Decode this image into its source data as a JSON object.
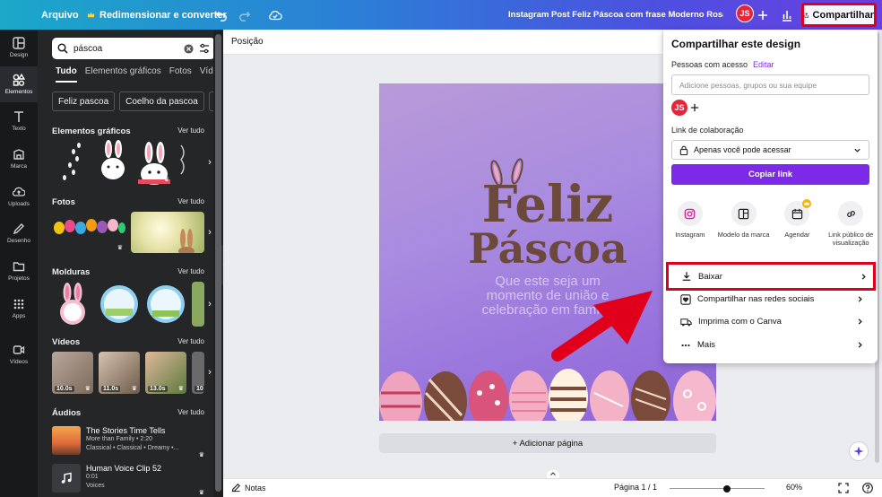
{
  "topbar": {
    "file_label": "Arquivo",
    "resize_label": "Redimensionar e converter",
    "doc_title": "Instagram Post Feliz Páscoa com frase Moderno Rosa e Mar...",
    "avatar_initials": "JS",
    "share_label": "Compartilhar"
  },
  "rail": {
    "items": [
      "Design",
      "Elementos",
      "Texto",
      "Marca",
      "Uploads",
      "Desenho",
      "Projetos",
      "Apps",
      "Vídeos"
    ]
  },
  "panel": {
    "search_value": "páscoa",
    "tabs": [
      "Tudo",
      "Elementos gráficos",
      "Fotos",
      "Vídeo"
    ],
    "chips": [
      "Feliz pascoa",
      "Coelho da pascoa",
      "C"
    ],
    "see_all": "Ver tudo",
    "sections": {
      "graphics": "Elementos gráficos",
      "photos": "Fotos",
      "frames": "Molduras",
      "videos": "Vídeos",
      "audios": "Áudios"
    },
    "video_durations": [
      "10.0s",
      "11.0s",
      "13.0s",
      "10"
    ],
    "audios": [
      {
        "title": "The Stories Time Tells",
        "artist": "More than Family • 2:20",
        "tags": "Classical • Classical • Dreamy •..."
      },
      {
        "title": "Human Voice Clip 52",
        "artist": "0:01",
        "tags": "Voices"
      }
    ]
  },
  "subbar": {
    "position_label": "Posição"
  },
  "design": {
    "line1": "Feliz",
    "line2": "Páscoa",
    "phrase": [
      "Que este seja um",
      "momento de união e",
      "celebração em família"
    ]
  },
  "add_page_label": "+ Adicionar página",
  "footer": {
    "notes_label": "Notas",
    "page_label": "Página 1 / 1",
    "zoom_label": "60%",
    "zoom_value": 0.6
  },
  "share_panel": {
    "title": "Compartilhar este design",
    "people_label": "Pessoas com acesso",
    "edit_label": "Editar",
    "add_placeholder": "Adicione pessoas, grupos ou sua equipe",
    "collab_label": "Link de colaboração",
    "access_value": "Apenas você pode acessar",
    "copy_link_label": "Copiar link",
    "options": [
      "Instagram",
      "Modelo da marca",
      "Agendar",
      "Link público de visualização"
    ],
    "menu": [
      "Baixar",
      "Compartilhar nas redes sociais",
      "Imprima com o Canva",
      "Mais"
    ]
  },
  "colors": {
    "accent": "#7d2ae8",
    "highlight": "#e0001b",
    "title_brown": "#6b4a3c"
  }
}
